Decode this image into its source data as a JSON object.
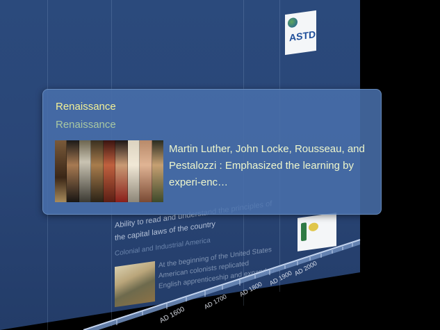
{
  "popup": {
    "title": "Renaissance",
    "subtitle": "Renaissance",
    "description": "Martin Luther, John Locke, Rousseau, and Pestalozzi : Emphasized the learning by experi-enc…",
    "image_icon": "portrait-collage-icon"
  },
  "background": {
    "event_line_1": "Ability to read and understand the principles of",
    "event_line_2": "the capital laws of the country",
    "era_label": "Colonial and Industrial America",
    "entry_line_1": "At the beginning of the United States",
    "entry_line_2": "American colonists replicated",
    "entry_line_3": "English apprenticeship and expanded..."
  },
  "logos": {
    "top": "ASTD",
    "top_icon": "globe-icon",
    "bottom_icon": "organization-seal-icon"
  },
  "timeline": {
    "ticks": [
      "AD 1600",
      "AD 1700",
      "AD 1800",
      "AD 1900",
      "AD 2000"
    ]
  },
  "colors": {
    "wall": "#2a4677",
    "popup": "#486eaa",
    "popup_title": "#f3f096",
    "popup_subtitle": "#a9c8a2",
    "popup_text": "#eef6cc"
  }
}
